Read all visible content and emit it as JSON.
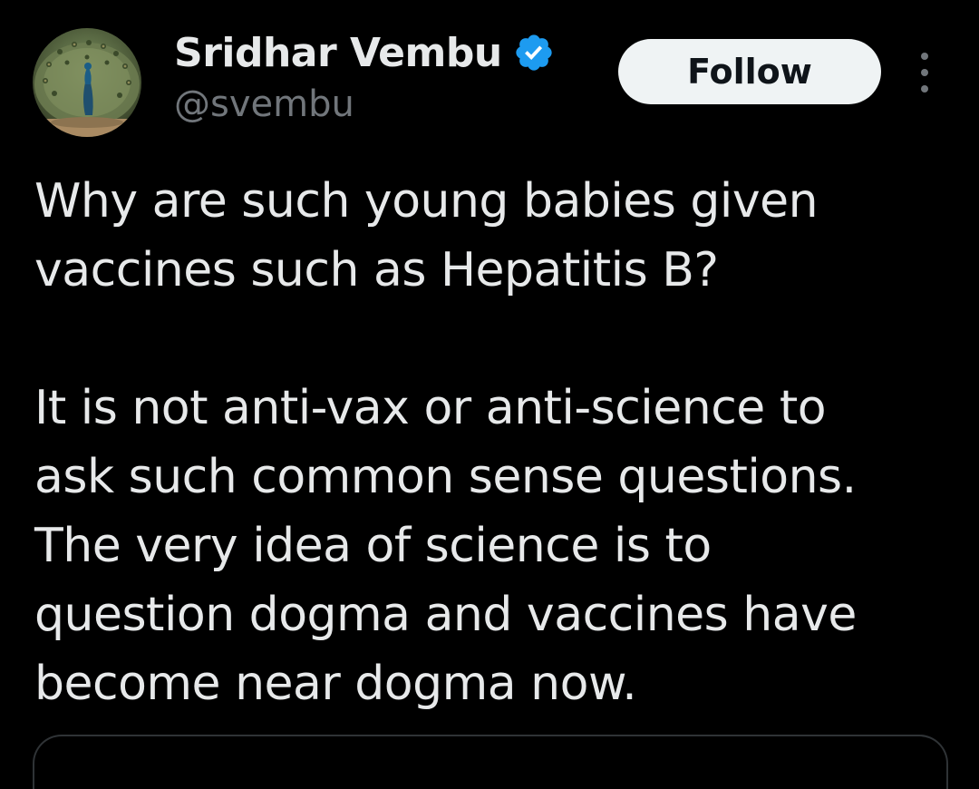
{
  "author": {
    "display_name": "Sridhar Vembu",
    "handle": "@svembu",
    "verified": true,
    "avatar": "peacock-avatar"
  },
  "actions": {
    "follow_label": "Follow",
    "more_icon": "more-vertical-icon"
  },
  "tweet": {
    "paragraph1": [
      "Why are such young babies given",
      "vaccines such as Hepatitis B?"
    ],
    "paragraph2": [
      "It is not anti-vax or anti-science to",
      "ask such common sense questions.",
      "The very idea of science is to",
      "question dogma and vaccines have",
      "become near dogma now."
    ]
  },
  "colors": {
    "background": "#000000",
    "text_primary": "#e7e9ea",
    "text_secondary": "#71767b",
    "verified_blue": "#1d9bf0",
    "follow_bg": "#eff3f4",
    "follow_text": "#0f1419"
  }
}
